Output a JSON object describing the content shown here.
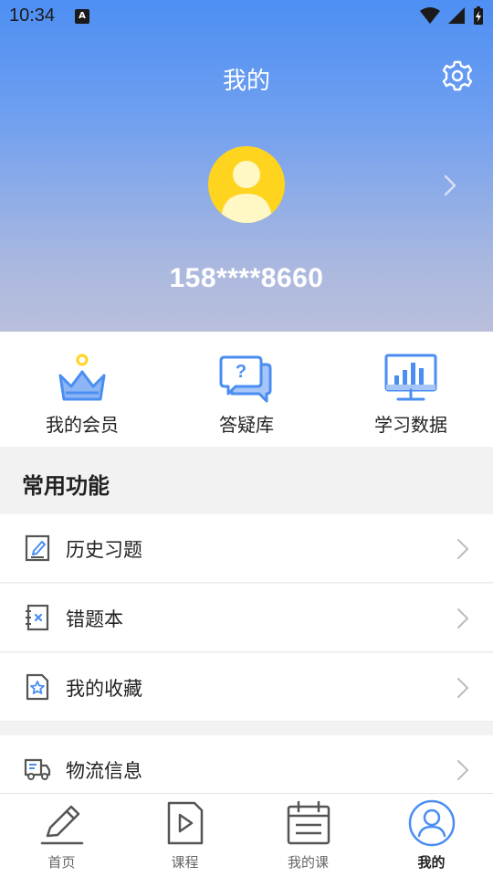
{
  "status_bar": {
    "time": "10:34",
    "notification_glyph": "A"
  },
  "header": {
    "title": "我的",
    "phone": "158****8660"
  },
  "quick_actions": [
    {
      "label": "我的会员",
      "icon": "crown-icon"
    },
    {
      "label": "答疑库",
      "icon": "question-chat-icon"
    },
    {
      "label": "学习数据",
      "icon": "chart-monitor-icon"
    }
  ],
  "section": {
    "title": "常用功能"
  },
  "menu": [
    {
      "label": "历史习题",
      "icon": "edit-document-icon"
    },
    {
      "label": "错题本",
      "icon": "error-notebook-icon"
    },
    {
      "label": "我的收藏",
      "icon": "star-document-icon"
    },
    {
      "label": "物流信息",
      "icon": "delivery-truck-icon"
    }
  ],
  "tabs": [
    {
      "label": "首页",
      "icon": "pen-icon"
    },
    {
      "label": "课程",
      "icon": "play-document-icon"
    },
    {
      "label": "我的课",
      "icon": "calendar-icon"
    },
    {
      "label": "我的",
      "icon": "user-circle-icon",
      "active": true
    }
  ],
  "colors": {
    "accent": "#4d8ff3",
    "avatar": "#ffd41f",
    "icon_blue": "#4a8ef2",
    "icon_gray": "#555555"
  }
}
